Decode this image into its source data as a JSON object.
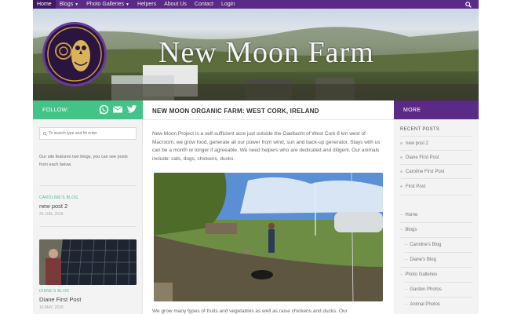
{
  "nav": {
    "items": [
      {
        "label": "Home",
        "active": true
      },
      {
        "label": "Blogs",
        "dropdown": true
      },
      {
        "label": "Photo Galleries",
        "dropdown": true
      },
      {
        "label": "Helpers"
      },
      {
        "label": "About Us"
      },
      {
        "label": "Contact"
      },
      {
        "label": "Login"
      }
    ],
    "search_icon": "search-icon"
  },
  "header": {
    "site_title": "New Moon Farm",
    "logo": "owl-logo"
  },
  "follow": {
    "label": "FOLLOW:",
    "icons": [
      "whatsapp-icon",
      "mail-icon",
      "twitter-icon"
    ]
  },
  "left_sidebar": {
    "search_placeholder": "To search type and hit enter",
    "intro": "Our site features two blogs, you can see posts from each below.",
    "posts": [
      {
        "category": "CAROLINE'S BLOG",
        "title": "new post 2",
        "date": "26 JUN, 2018"
      },
      {
        "category": "DIANE'S BLOG",
        "title": "Diane First Post",
        "date": "16 MAY, 2018"
      }
    ]
  },
  "main": {
    "heading": "NEW MOON ORGANIC FARM: WEST CORK, IRELAND",
    "paragraph": "New Moon Project is a self-sufficient acre just outside the Gaeltacht of West Cork 8 km west of Macroom, we grow food, generate all our power from wind, sun and back-up generator. Stays with us can be a month or longer if agreeable. We need helpers who are dedicated and diligent. Our animals include: cats, dogs, chickens, ducks.",
    "paragraph2": "We grow many types of fruits and vegetables as well as raise chickens and ducks. Our"
  },
  "right_sidebar": {
    "more_label": "MORE",
    "recent_title": "RECENT POSTS",
    "recent": [
      "new post 2",
      "Diane First Post",
      "Caroline First Post",
      "First Post"
    ],
    "menu": [
      {
        "label": "Home",
        "level": 1
      },
      {
        "label": "Blogs",
        "level": 1
      },
      {
        "label": "Caroline's Blog",
        "level": 2
      },
      {
        "label": "Diane's Blog",
        "level": 2
      },
      {
        "label": "Photo Galleries",
        "level": 1
      },
      {
        "label": "Garden Photos",
        "level": 2
      },
      {
        "label": "Animal Photos",
        "level": 2
      }
    ]
  },
  "colors": {
    "nav_purple": "#5a2a86",
    "follow_green": "#44c389",
    "sidebar_bg": "#f3f3f3"
  }
}
